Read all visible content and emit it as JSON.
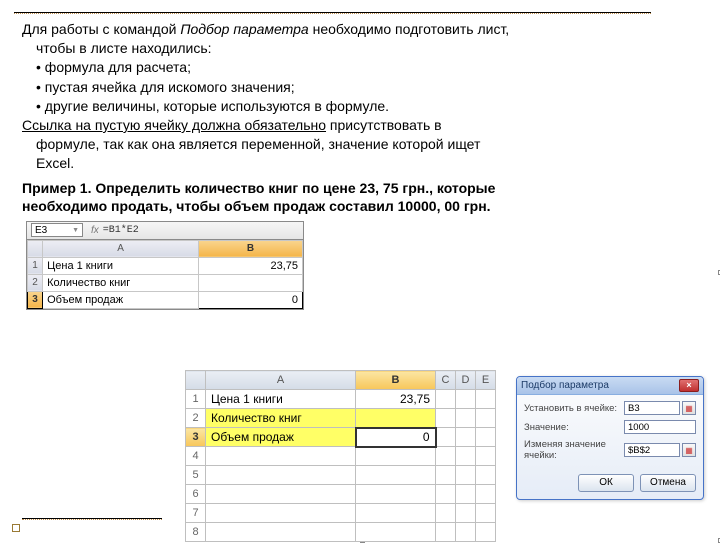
{
  "intro": {
    "line1_a": "Для работы с командой ",
    "line1_italic": "Подбор параметра",
    "line1_b": " необходимо подготовить лист,",
    "line2": "чтобы в листе находились:",
    "bullet1": "формула для расчета;",
    "bullet2": "пустая ячейка для искомого значения;",
    "bullet3": "другие величины, которые используются в формуле.",
    "line6_u": "Ссылка на пустую ячейку должна обязательно",
    "line6_b": " присутствовать в",
    "line7": "формуле, так как она является переменной, значение которой ищет",
    "line8": "Excel."
  },
  "example": {
    "l1": "Пример 1. Определить количество книг по цене 23, 75 грн., которые",
    "l2": "необходимо продать, чтобы объем продаж составил 10000, 00 грн."
  },
  "sheet1": {
    "namebox": "E3",
    "fx": "fx",
    "formula": "=B1*E2",
    "colA": "A",
    "colB": "B",
    "r1": "1",
    "r2": "2",
    "r3": "3",
    "a1": "Цена 1 книги",
    "b1": "23,75",
    "a2": "Количество книг",
    "b2": "",
    "a3": "Объем продаж",
    "b3": "0"
  },
  "sheet2": {
    "hA": "A",
    "hB": "B",
    "hC": "C",
    "hD": "D",
    "hE": "E",
    "r": [
      "1",
      "2",
      "3",
      "4",
      "5",
      "6",
      "7",
      "8"
    ],
    "a1": "Цена 1 книги",
    "b1": "23,75",
    "a2": "Количество книг",
    "b2": "",
    "a3": "Объем продаж",
    "b3": "0"
  },
  "dialog": {
    "title": "Подбор параметра",
    "f1_label": "Установить в ячейке:",
    "f1_value": "B3",
    "f2_label": "Значение:",
    "f2_value": "1000",
    "f3_label": "Изменяя значение ячейки:",
    "f3_value": "$B$2",
    "ok": "ОК",
    "cancel": "Отмена"
  }
}
